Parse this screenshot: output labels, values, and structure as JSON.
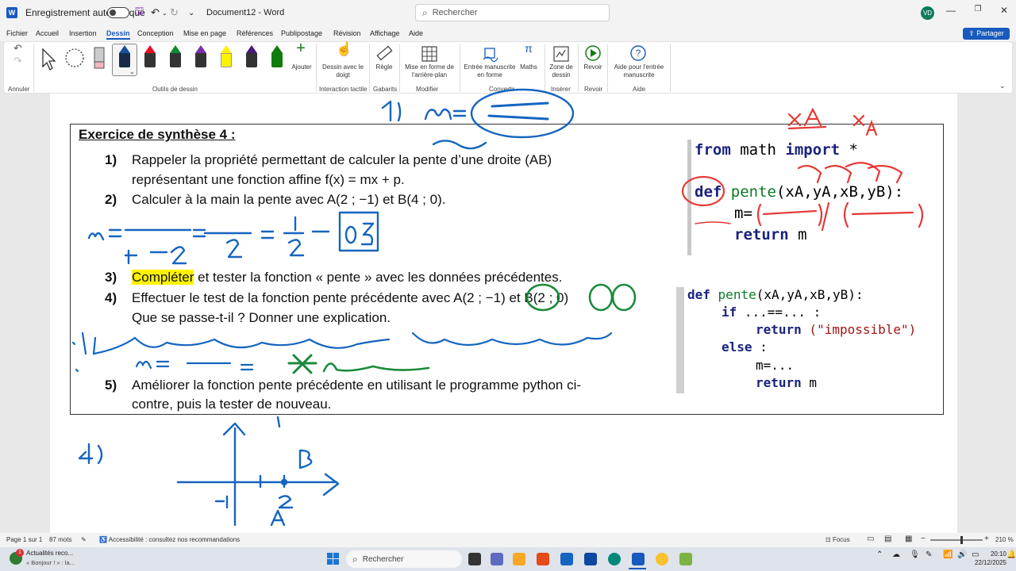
{
  "titlebar": {
    "autosave_label": "Enregistrement automatique",
    "doc_title": "Document12  -  Word",
    "search_placeholder": "Rechercher",
    "user_initials": "VD"
  },
  "menu": {
    "tabs": [
      "Fichier",
      "Accueil",
      "Insertion",
      "Dessin",
      "Conception",
      "Mise en page",
      "Références",
      "Publipostage",
      "Révision",
      "Affichage",
      "Aide"
    ],
    "active": "Dessin",
    "share": "Partager"
  },
  "ribbon": {
    "groups": {
      "undo": "Annuler",
      "drawing_tools": "Outils de dessin",
      "touch": "Interaction tactile",
      "templates": "Gabarits",
      "modify": "Modifier",
      "convert": "Convertir",
      "insert": "Insérer",
      "replay": "Revoir",
      "help": "Aide"
    },
    "buttons": {
      "add": "Ajouter",
      "draw_finger": "Dessin avec le doigt",
      "ruler": "Règle",
      "background": "Mise en forme de l'arrière-plan",
      "ink_to_shape": "Entrée manuscrite en forme",
      "math": "Maths",
      "drawing_zone": "Zone de dessin",
      "replay": "Revoir",
      "ink_help": "Aide pour l'entrée manuscrite"
    },
    "pen_colors": [
      "#2c2c2c",
      "#1a4fa0",
      "#e81123",
      "#0f8a2e",
      "#7b2fb0",
      "#fff200",
      "#4a1a7a",
      "#107c10"
    ]
  },
  "exercise": {
    "title": "Exercice de synthèse 4 :",
    "q1_num": "1)",
    "q1_line1": "Rappeler la propriété permettant de calculer la pente d’une droite (AB)",
    "q1_line2": "représentant une fonction affine f(x) = mx + p.",
    "q2_num": "2)",
    "q2_line": "Calculer à la main la pente avec A(2 ; −1) et B(4 ; 0).",
    "q3_num": "3)",
    "q3_highlight": "Compléter",
    "q3_rest": " et tester la fonction « pente » avec les données précédentes.",
    "q4_num": "4)",
    "q4_line1": "Effectuer le test de la fonction pente précédente avec A(2 ; −1) et B(2 ; 0)",
    "q4_line2": "Que se passe-t-il ? Donner une explication.",
    "q5_num": "5)",
    "q5_line1": "Améliorer la fonction pente précédente en utilisant le programme python ci-",
    "q5_line2": "contre, puis la tester de nouveau."
  },
  "code1": {
    "l1_kw1": "from",
    "l1_mid": " math ",
    "l1_kw2": "import",
    "l1_end": " *",
    "l2_kw": "def",
    "l2_fn": "pente",
    "l2_args": "(xA,yA,xB,yB):",
    "l3": "m=",
    "l4_kw": "return",
    "l4_end": " m"
  },
  "code2": {
    "l1_kw": "def",
    "l1_fn": "pente",
    "l1_args": "(xA,yA,xB,yB):",
    "l2_kw": "if",
    "l2_end": " ...==... :",
    "l3_kw": "return",
    "l3_str": " (\"impossible\")",
    "l4_kw": "else",
    "l4_end": " :",
    "l5": "m=...",
    "l6_kw": "return",
    "l6_end": " m"
  },
  "status": {
    "page": "Page 1 sur 1",
    "words": "87 mots",
    "accessibility": "Accessibilité : consultez nos recommandations",
    "focus": "Focus",
    "zoom": "210 %"
  },
  "taskbar": {
    "news_title": "Actualités reco...",
    "news_sub": "« Bonjour ! » : la...",
    "search": "Rechercher",
    "time": "20:10",
    "date": "22/12/2025",
    "badge": "1"
  }
}
